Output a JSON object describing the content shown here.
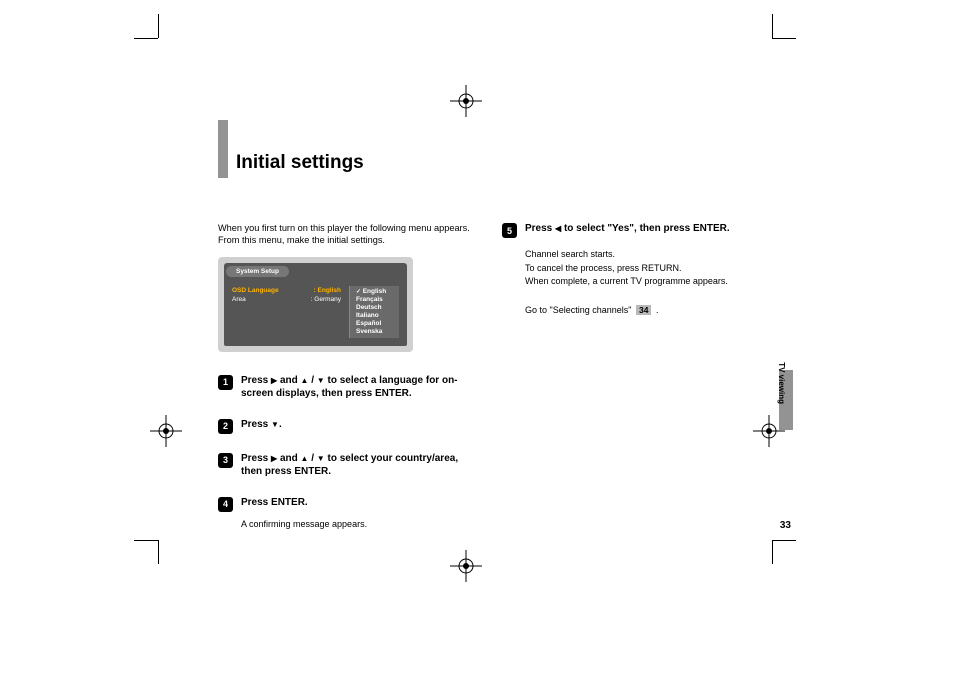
{
  "heading": "Initial settings",
  "intro": "When you first turn on this player the following menu appears. From this menu, make the initial settings.",
  "osd": {
    "tab": "System Setup",
    "rows": [
      {
        "label": "OSD Language",
        "value": ": English",
        "selected": true
      },
      {
        "label": "Area",
        "value": ": Germany",
        "selected": false
      }
    ],
    "options": [
      "English",
      "Français",
      "Deutsch",
      "Italiano",
      "Español",
      "Svenska"
    ]
  },
  "steps": {
    "s1": {
      "num": "1",
      "pre": "Press ",
      "mid": " and ",
      "post": " to select a language for on-screen displays, then press ENTER."
    },
    "s2": {
      "num": "2",
      "pre": "Press ",
      "post": "."
    },
    "s3": {
      "num": "3",
      "pre": "Press ",
      "mid": " and ",
      "post": " to select your country/area, then press ENTER."
    },
    "s4": {
      "num": "4",
      "text": "Press ENTER.",
      "sub": "A confirming message appears."
    },
    "s5": {
      "num": "5",
      "pre": "Press ",
      "post": " to select \"Yes\", then press ENTER.",
      "sub1": "Channel search starts.",
      "sub2": "To cancel the process, press RETURN.",
      "sub3": "When complete, a current TV programme appears."
    }
  },
  "goto": {
    "pre": "Go to \"Selecting channels\" ",
    "ref": "34",
    "post": " ."
  },
  "sideTab": "TV viewing",
  "pageNumber": "33",
  "glyphs": {
    "right": "▶",
    "left": "◀",
    "up": "▲",
    "down": "▼",
    "slash": " / "
  }
}
